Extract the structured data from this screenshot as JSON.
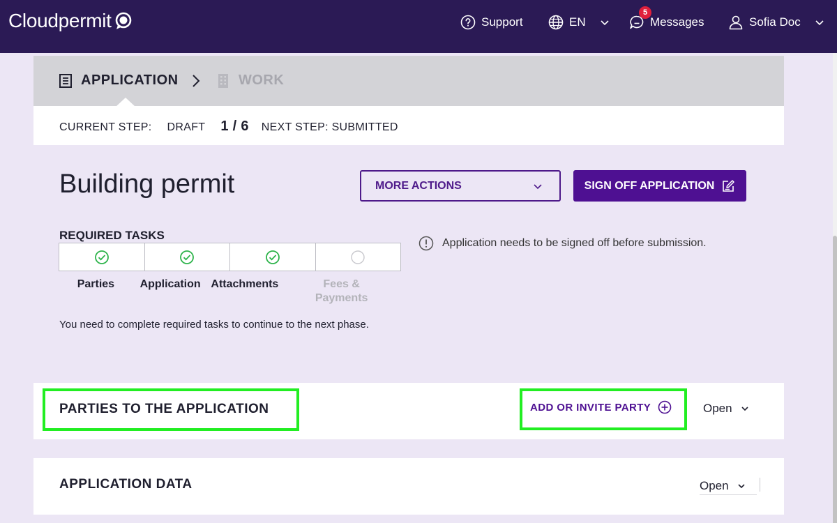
{
  "header": {
    "brand": "Cloudpermit",
    "support_label": "Support",
    "language_label": "EN",
    "messages_label": "Messages",
    "messages_count": "5",
    "user_name": "Sofia Doc"
  },
  "stepper": {
    "steps": [
      {
        "label": "APPLICATION",
        "active": true
      },
      {
        "label": "WORK",
        "active": false
      }
    ],
    "current_step_label": "CURRENT STEP:",
    "current_step_value": "DRAFT",
    "progress": "1 / 6",
    "next_step": "NEXT STEP: SUBMITTED"
  },
  "page": {
    "title": "Building permit",
    "more_actions_label": "MORE ACTIONS",
    "sign_off_label": "SIGN OFF APPLICATION",
    "info_message": "Application needs to be signed off before submission."
  },
  "required_tasks": {
    "title": "REQUIRED TASKS",
    "tasks": [
      {
        "label": "Parties",
        "done": true
      },
      {
        "label": "Application",
        "done": true
      },
      {
        "label": "Attachments",
        "done": true
      },
      {
        "label": "Fees & Payments",
        "done": false
      }
    ],
    "note": "You need to complete required tasks to continue to the next phase."
  },
  "sections": {
    "parties": {
      "title": "PARTIES TO THE APPLICATION",
      "add_label": "ADD OR INVITE PARTY",
      "toggle_label": "Open"
    },
    "app_data": {
      "title": "APPLICATION DATA",
      "toggle_label": "Open"
    }
  },
  "colors": {
    "header_bg": "#2b1a55",
    "accent": "#4e1092",
    "page_bg": "#ece6f5",
    "success": "#2db34a",
    "highlight": "#22ee22",
    "badge": "#e0203c"
  }
}
